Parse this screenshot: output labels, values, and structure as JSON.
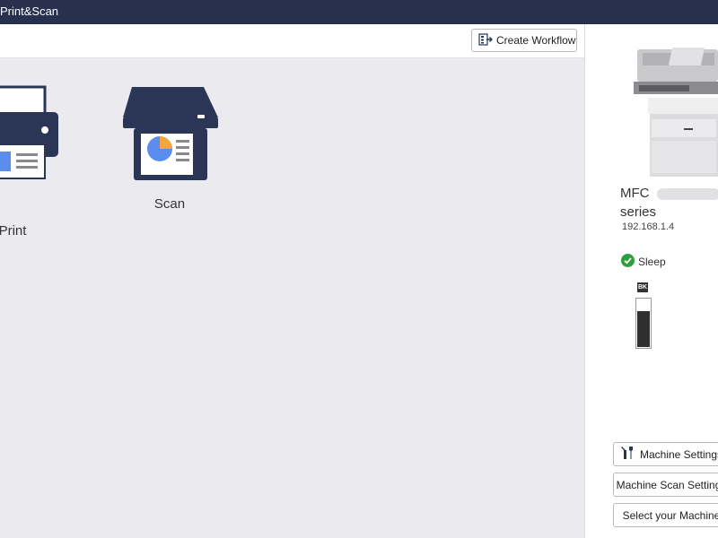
{
  "window": {
    "title": "Print&Scan"
  },
  "toolbar": {
    "create_workflow_label": "Create Workflow"
  },
  "tiles": [
    {
      "label": "Print",
      "icon": "printer-icon"
    },
    {
      "label": "Scan",
      "icon": "scanner-icon"
    }
  ],
  "device": {
    "model_prefix": "MFC",
    "model_suffix": "series",
    "ip": "192.168.1.4",
    "status": "Sleep",
    "ink": {
      "label": "BK",
      "level": 0.75
    }
  },
  "side_buttons": {
    "machine_settings": "Machine Settings",
    "machine_scan_settings": "Machine Scan Settings",
    "select_machine": "Select your Machine"
  },
  "colors": {
    "titlebar": "#27304f",
    "icon_navy": "#2b3656",
    "accent_blue": "#5b8dee",
    "accent_orange": "#f2a83b",
    "status_green": "#2e9e3e"
  }
}
